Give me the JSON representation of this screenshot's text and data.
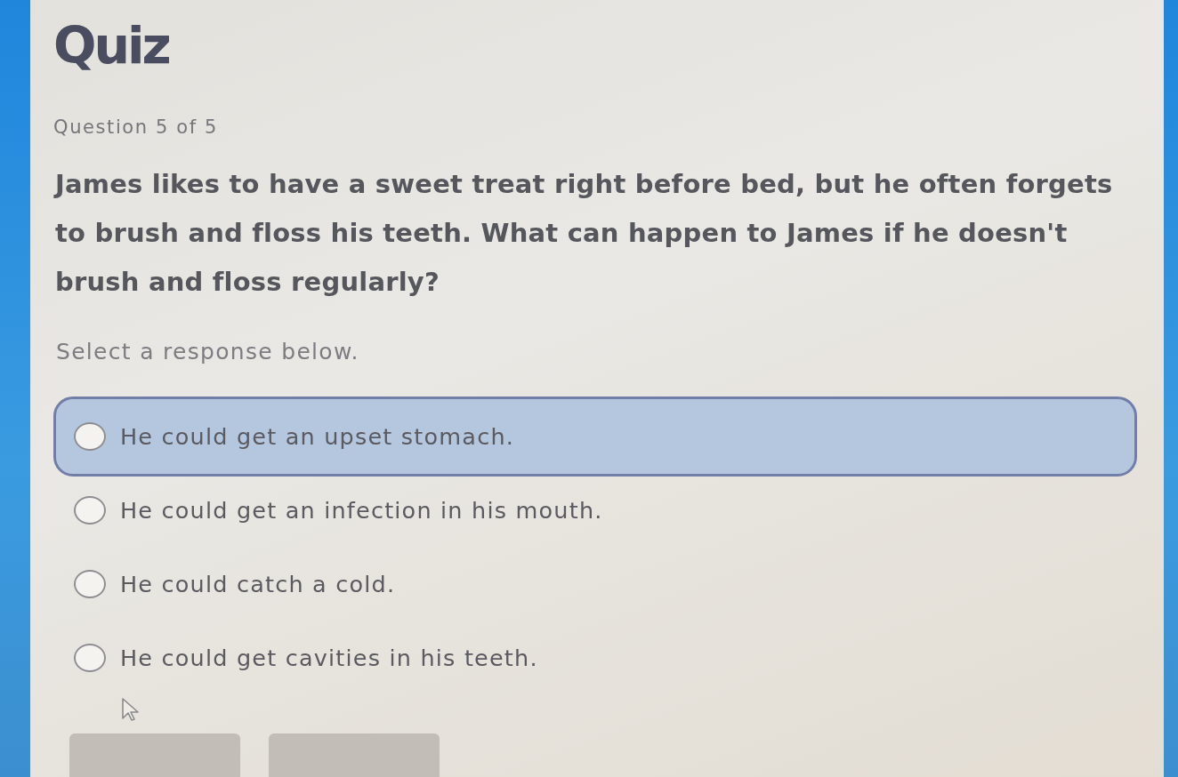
{
  "title": "Quiz",
  "progress": "Question 5 of 5",
  "question": "James likes to have a sweet treat right before bed, but he often forgets to brush and floss his teeth. What can happen to James if he doesn't brush and floss regularly?",
  "instruction": "Select a response below.",
  "options": [
    {
      "label": "He could get an upset stomach.",
      "selected": false,
      "highlighted": true
    },
    {
      "label": "He could get an infection in his mouth.",
      "selected": false,
      "highlighted": false
    },
    {
      "label": "He could catch a cold.",
      "selected": false,
      "highlighted": false
    },
    {
      "label": "He could get cavities in his teeth.",
      "selected": false,
      "highlighted": false
    }
  ],
  "buttons": [
    {
      "disabled": true
    },
    {
      "disabled": true
    }
  ]
}
